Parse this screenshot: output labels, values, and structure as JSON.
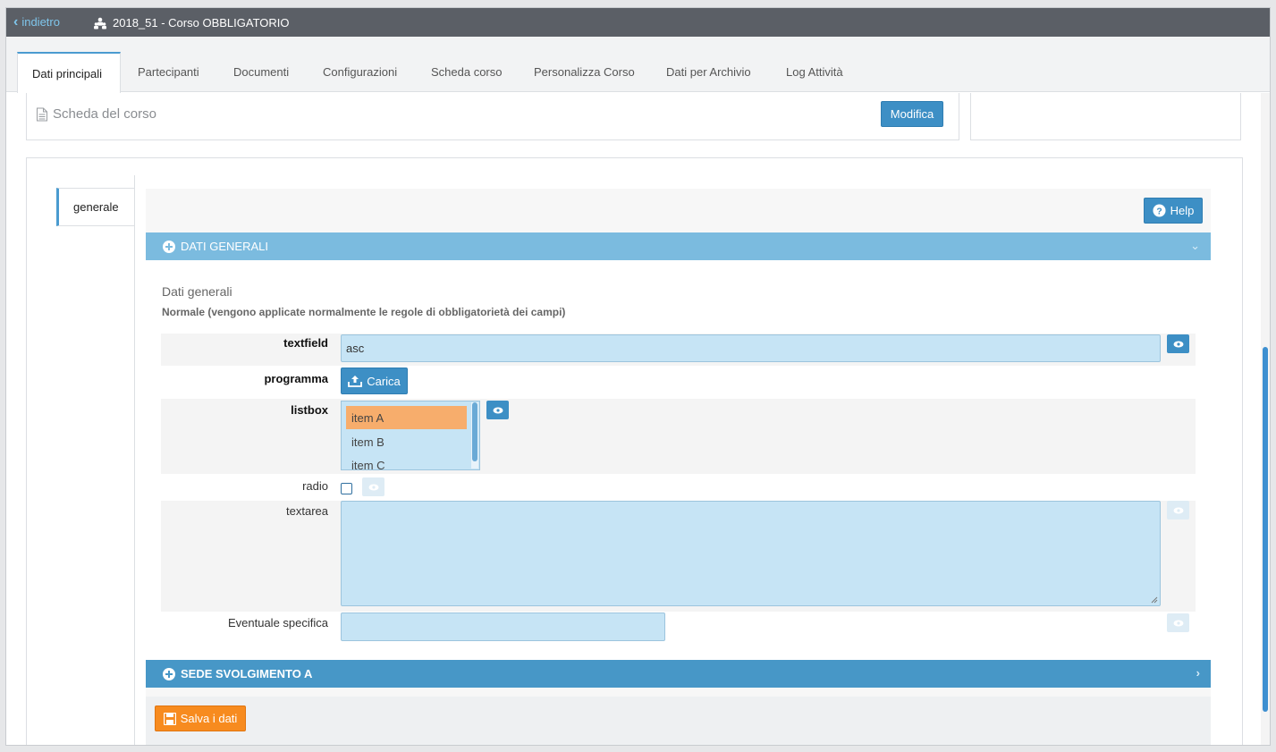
{
  "topbar": {
    "back_label": "indietro",
    "course_title": "2018_51 - Corso OBBLIGATORIO"
  },
  "tabs": [
    {
      "label": "Dati principali",
      "active": true
    },
    {
      "label": "Partecipanti"
    },
    {
      "label": "Documenti"
    },
    {
      "label": "Configurazioni"
    },
    {
      "label": "Scheda corso"
    },
    {
      "label": "Personalizza Corso"
    },
    {
      "label": "Dati per Archivio"
    },
    {
      "label": "Log Attività"
    }
  ],
  "course_card": {
    "title": "Scheda del corso",
    "edit_label": "Modifica"
  },
  "side_tab": {
    "label": "generale"
  },
  "help_label": "Help",
  "section_general": {
    "header": "DATI GENERALI",
    "title": "Dati generali",
    "subtitle": "Normale (vengono applicate normalmente le regole di obbligatorietà dei campi)"
  },
  "fields": {
    "textfield": {
      "label": "textfield",
      "value": "asc"
    },
    "programma": {
      "label": "programma",
      "button": "Carica"
    },
    "listbox": {
      "label": "listbox",
      "items": [
        "item A",
        "item B",
        "item C"
      ],
      "selected": "item A"
    },
    "radio": {
      "label": "radio",
      "checked": false
    },
    "textarea": {
      "label": "textarea",
      "value": ""
    },
    "specifica": {
      "label": "Eventuale specifica",
      "value": ""
    }
  },
  "section_sede": {
    "header": "SEDE SVOLGIMENTO A"
  },
  "save_label": "Salva i dati",
  "colors": {
    "topbar": "#5b5f66",
    "accent": "#3d8fc5",
    "section_light": "#7bbbdf",
    "section_dark": "#4797c7",
    "input_bg": "#c6e4f5",
    "selected_item": "#f7ad6c",
    "save_button": "#f78b1f"
  },
  "icons": {
    "back": "chevron-left-icon",
    "course": "people-icon",
    "card": "document-icon",
    "help": "question-circle-icon",
    "expand": "plus-circle-icon",
    "collapse": "chevron-down-icon",
    "visibility": "eye-icon",
    "upload": "upload-icon",
    "save": "floppy-disk-icon"
  }
}
